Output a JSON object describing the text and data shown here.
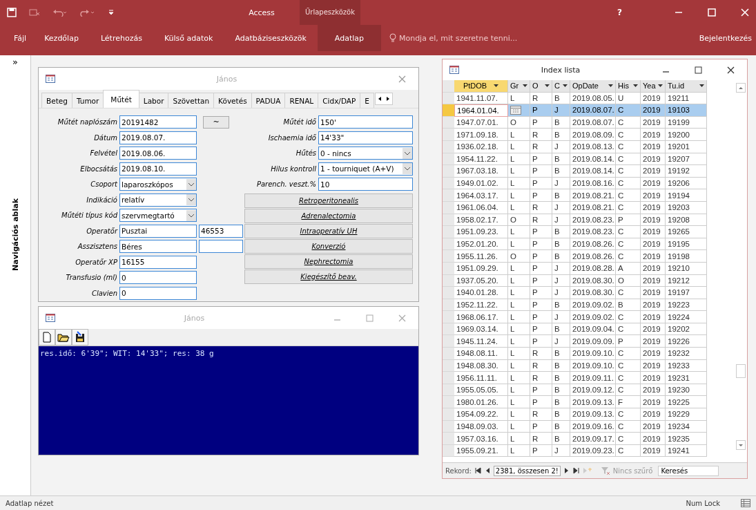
{
  "app": {
    "title": "Access",
    "context_group": "Űrlapeszközök",
    "tell_me": "Mondja el, mit szeretne tenni...",
    "sign_in": "Bejelentkezés",
    "help": "?"
  },
  "ribbon_tabs": [
    {
      "label": "Fájl",
      "selected": false
    },
    {
      "label": "Kezdőlap",
      "selected": false
    },
    {
      "label": "Létrehozás",
      "selected": false
    },
    {
      "label": "Külső adatok",
      "selected": false
    },
    {
      "label": "Adatbáziseszközök",
      "selected": false
    },
    {
      "label": "Adatlap",
      "selected": true
    }
  ],
  "nav_pane": {
    "toggle": "»",
    "label": "Navigációs ablak"
  },
  "form": {
    "title": "János",
    "tabs": [
      {
        "label": "Beteg",
        "selected": false
      },
      {
        "label": "Tumor",
        "selected": false
      },
      {
        "label": "Műtét",
        "selected": true
      },
      {
        "label": "Labor",
        "selected": false
      },
      {
        "label": "Szövettan",
        "selected": false
      },
      {
        "label": "Követés",
        "selected": false
      },
      {
        "label": "PADUA",
        "selected": false
      },
      {
        "label": "RENAL",
        "selected": false
      },
      {
        "label": "Cidx/DAP",
        "selected": false
      },
      {
        "label": "E",
        "selected": false
      }
    ],
    "tilde_button": "~",
    "left_fields": [
      {
        "label": "Műtét naplószám",
        "value": "20191482",
        "kind": "text"
      },
      {
        "label": "Dátum",
        "value": "2019.08.07.",
        "kind": "text"
      },
      {
        "label": "Felvétel",
        "value": "2019.08.06.",
        "kind": "text"
      },
      {
        "label": "Elbocsátás",
        "value": "2019.08.10.",
        "kind": "text"
      },
      {
        "label": "Csoport",
        "value": "laparoszkópos",
        "kind": "combo"
      },
      {
        "label": "Indikáció",
        "value": "relatív",
        "kind": "combo"
      },
      {
        "label": "Műtéti típus kód",
        "value": "szervmegtartó",
        "kind": "combo"
      },
      {
        "label": "Operatőr",
        "value": "Pusztai",
        "kind": "text",
        "extra_field": true,
        "extra": "46553"
      },
      {
        "label": "Asszisztens",
        "value": "Béres",
        "kind": "text",
        "extra_field": true
      },
      {
        "label": "Operatőr XP",
        "value": "16155",
        "kind": "text"
      },
      {
        "label": "Transfusio (ml)",
        "value": "0",
        "kind": "text"
      },
      {
        "label": "Clavien",
        "value": "0",
        "kind": "text"
      }
    ],
    "right_fields": [
      {
        "label": "Műtét idő",
        "value": "150'",
        "kind": "text"
      },
      {
        "label": "Ischaemia idő",
        "value": "14'33\"",
        "kind": "text"
      },
      {
        "label": "Hűtés",
        "value": "0 - nincs",
        "kind": "combo"
      },
      {
        "label": "Hilus kontroll",
        "value": "1 - tourniquet (A+V)",
        "kind": "combo"
      },
      {
        "label": "Parench. veszt.%",
        "value": "10",
        "kind": "text"
      }
    ],
    "buttons": [
      "Retroperitonealis",
      "Adrenalectomia",
      "Intraoperatív UH",
      "Konverzió",
      "Nephrectomia",
      "Kiegészítő beav."
    ]
  },
  "console": {
    "title": "János",
    "output": "res.idő: 6'39\"; WIT: 14'33\"; res: 38 g"
  },
  "index_list": {
    "title": "Index lista",
    "columns": [
      "PtDOB",
      "Gr",
      "O",
      "C",
      "OpDate",
      "His",
      "Yea",
      "Tu.id"
    ],
    "rows": [
      {
        "cells": [
          "1941.11.07.",
          "L",
          "R",
          "B",
          "2019.08.05.",
          "U",
          "2019",
          "19211"
        ],
        "selected": false
      },
      {
        "cells": [
          "1964.01.04.",
          null,
          "P",
          "J",
          "2019.08.07.",
          "C",
          "2019",
          "19103"
        ],
        "selected": true
      },
      {
        "cells": [
          "1947.07.01.",
          "O",
          "P",
          "B",
          "2019.08.07.",
          "C",
          "2019",
          "19199"
        ],
        "selected": false
      },
      {
        "cells": [
          "1971.09.18.",
          "L",
          "R",
          "B",
          "2019.08.09.",
          "C",
          "2019",
          "19200"
        ],
        "selected": false
      },
      {
        "cells": [
          "1936.02.18.",
          "L",
          "R",
          "J",
          "2019.08.13.",
          "C",
          "2019",
          "19201"
        ],
        "selected": false
      },
      {
        "cells": [
          "1954.11.22.",
          "L",
          "P",
          "B",
          "2019.08.14.",
          "C",
          "2019",
          "19207"
        ],
        "selected": false
      },
      {
        "cells": [
          "1967.03.18.",
          "L",
          "P",
          "B",
          "2019.08.14.",
          "C",
          "2019",
          "19192"
        ],
        "selected": false
      },
      {
        "cells": [
          "1949.01.02.",
          "L",
          "P",
          "J",
          "2019.08.16.",
          "C",
          "2019",
          "19206"
        ],
        "selected": false
      },
      {
        "cells": [
          "1964.03.17.",
          "L",
          "P",
          "B",
          "2019.08.21.",
          "C",
          "2019",
          "19194"
        ],
        "selected": false
      },
      {
        "cells": [
          "1961.06.04.",
          "L",
          "R",
          "J",
          "2019.08.21.",
          "C",
          "2019",
          "19203"
        ],
        "selected": false
      },
      {
        "cells": [
          "1958.02.17.",
          "O",
          "R",
          "J",
          "2019.08.23.",
          "P",
          "2019",
          "19208"
        ],
        "selected": false
      },
      {
        "cells": [
          "1951.09.23.",
          "L",
          "P",
          "B",
          "2019.08.23.",
          "C",
          "2019",
          "19265"
        ],
        "selected": false
      },
      {
        "cells": [
          "1952.01.20.",
          "L",
          "P",
          "B",
          "2019.08.26.",
          "C",
          "2019",
          "19195"
        ],
        "selected": false
      },
      {
        "cells": [
          "1955.11.26.",
          "O",
          "P",
          "B",
          "2019.08.26.",
          "C",
          "2019",
          "19198"
        ],
        "selected": false
      },
      {
        "cells": [
          "1951.09.29.",
          "L",
          "P",
          "J",
          "2019.08.28.",
          "A",
          "2019",
          "19210"
        ],
        "selected": false
      },
      {
        "cells": [
          "1937.05.20.",
          "L",
          "P",
          "J",
          "2019.08.30.",
          "O",
          "2019",
          "19212"
        ],
        "selected": false
      },
      {
        "cells": [
          "1940.01.28.",
          "L",
          "P",
          "J",
          "2019.08.30.",
          "C",
          "2019",
          "19197"
        ],
        "selected": false
      },
      {
        "cells": [
          "1952.11.22.",
          "L",
          "P",
          "B",
          "2019.09.02.",
          "B",
          "2019",
          "19223"
        ],
        "selected": false
      },
      {
        "cells": [
          "1968.06.17.",
          "L",
          "P",
          "J",
          "2019.09.02.",
          "C",
          "2019",
          "19224"
        ],
        "selected": false
      },
      {
        "cells": [
          "1969.03.14.",
          "L",
          "P",
          "B",
          "2019.09.04.",
          "C",
          "2019",
          "19202"
        ],
        "selected": false
      },
      {
        "cells": [
          "1945.11.24.",
          "L",
          "P",
          "J",
          "2019.09.09.",
          "P",
          "2019",
          "19226"
        ],
        "selected": false
      },
      {
        "cells": [
          "1948.08.11.",
          "L",
          "R",
          "B",
          "2019.09.10.",
          "C",
          "2019",
          "19232"
        ],
        "selected": false
      },
      {
        "cells": [
          "1948.08.30.",
          "L",
          "R",
          "B",
          "2019.09.10.",
          "C",
          "2019",
          "19233"
        ],
        "selected": false
      },
      {
        "cells": [
          "1956.11.11.",
          "L",
          "R",
          "B",
          "2019.09.11.",
          "C",
          "2019",
          "19231"
        ],
        "selected": false
      },
      {
        "cells": [
          "1955.05.05.",
          "L",
          "P",
          "B",
          "2019.09.12.",
          "C",
          "2019",
          "19230"
        ],
        "selected": false
      },
      {
        "cells": [
          "1980.01.26.",
          "L",
          "P",
          "B",
          "2019.09.13.",
          "F",
          "2019",
          "19225"
        ],
        "selected": false
      },
      {
        "cells": [
          "1954.09.22.",
          "L",
          "R",
          "B",
          "2019.09.13.",
          "C",
          "2019",
          "19229"
        ],
        "selected": false
      },
      {
        "cells": [
          "1948.09.03.",
          "L",
          "P",
          "B",
          "2019.09.16.",
          "C",
          "2019",
          "19234"
        ],
        "selected": false
      },
      {
        "cells": [
          "1957.03.16.",
          "L",
          "R",
          "B",
          "2019.09.17.",
          "C",
          "2019",
          "19235"
        ],
        "selected": false
      },
      {
        "cells": [
          "1955.09.21.",
          "L",
          "P",
          "J",
          "2019.09.23.",
          "C",
          "2019",
          "19241"
        ],
        "selected": false
      }
    ],
    "navigator": {
      "label": "Rekord:",
      "record": "2381, összesen 2!",
      "filter": "Nincs szűrő",
      "search": "Keresés"
    }
  },
  "status_bar": {
    "view": "Adatlap nézet",
    "num_lock": "Num Lock"
  }
}
